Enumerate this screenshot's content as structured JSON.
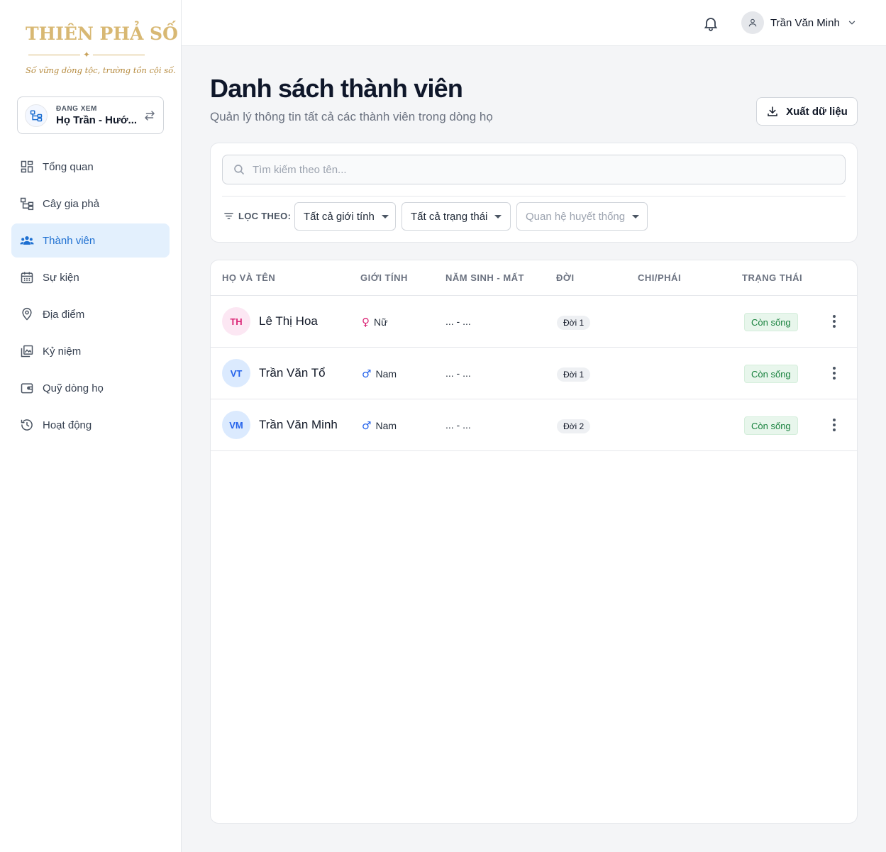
{
  "brand": {
    "logo_text": "THIÊN PHẢ SỐ",
    "tagline": "Số vững dòng tộc, trường tồn cội số."
  },
  "clan_switcher": {
    "caption": "ĐANG XEM",
    "name": "Họ Trần - Hướ...",
    "icon": "family-tree-icon",
    "swap_icon": "swap-icon"
  },
  "sidebar": {
    "items": [
      {
        "label": "Tổng quan",
        "icon": "dashboard-icon",
        "active": false
      },
      {
        "label": "Cây gia phả",
        "icon": "family-tree-icon",
        "active": false
      },
      {
        "label": "Thành viên",
        "icon": "people-icon",
        "active": true
      },
      {
        "label": "Sự kiện",
        "icon": "calendar-icon",
        "active": false
      },
      {
        "label": "Địa điểm",
        "icon": "location-pin-icon",
        "active": false
      },
      {
        "label": "Kỷ niệm",
        "icon": "photo-album-icon",
        "active": false
      },
      {
        "label": "Quỹ dòng họ",
        "icon": "wallet-icon",
        "active": false
      },
      {
        "label": "Hoạt động",
        "icon": "history-icon",
        "active": false
      }
    ]
  },
  "header": {
    "user_name": "Trần Văn Minh"
  },
  "page": {
    "title": "Danh sách thành viên",
    "subtitle": "Quản lý thông tin tất cả các thành viên trong dòng họ",
    "export_label": "Xuất dữ liệu"
  },
  "filters": {
    "search_placeholder": "Tìm kiếm theo tên...",
    "label": "LỌC THEO:",
    "gender": "Tất cả giới tính",
    "status": "Tất cả trạng thái",
    "lineage": "Quan hệ huyết thống"
  },
  "table": {
    "columns": [
      "HỌ VÀ TÊN",
      "GIỚI TÍNH",
      "NĂM SINH - MẤT",
      "ĐỜI",
      "CHI/PHÁI",
      "TRẠNG THÁI"
    ],
    "rows": [
      {
        "initials": "TH",
        "name": "Lê Thị Hoa",
        "gender_symbol": "♀",
        "gender": "Nữ",
        "years": "... - ...",
        "generation": "Đời 1",
        "branch": "",
        "status": "Còn sống"
      },
      {
        "initials": "VT",
        "name": "Trần Văn Tổ",
        "gender_symbol": "♂",
        "gender": "Nam",
        "years": "... - ...",
        "generation": "Đời 1",
        "branch": "",
        "status": "Còn sống"
      },
      {
        "initials": "VM",
        "name": "Trần Văn Minh",
        "gender_symbol": "♂",
        "gender": "Nam",
        "years": "... - ...",
        "generation": "Đời 2",
        "branch": "",
        "status": "Còn sống"
      }
    ]
  },
  "colors": {
    "accent": "#1d6fd1",
    "accent_bg": "#e3f0fd",
    "brand_gold": "#d8b873",
    "female": "#db2777",
    "female_bg": "#fce7f3",
    "male": "#2563eb",
    "male_bg": "#dbeafe",
    "alive": "#16803c"
  }
}
